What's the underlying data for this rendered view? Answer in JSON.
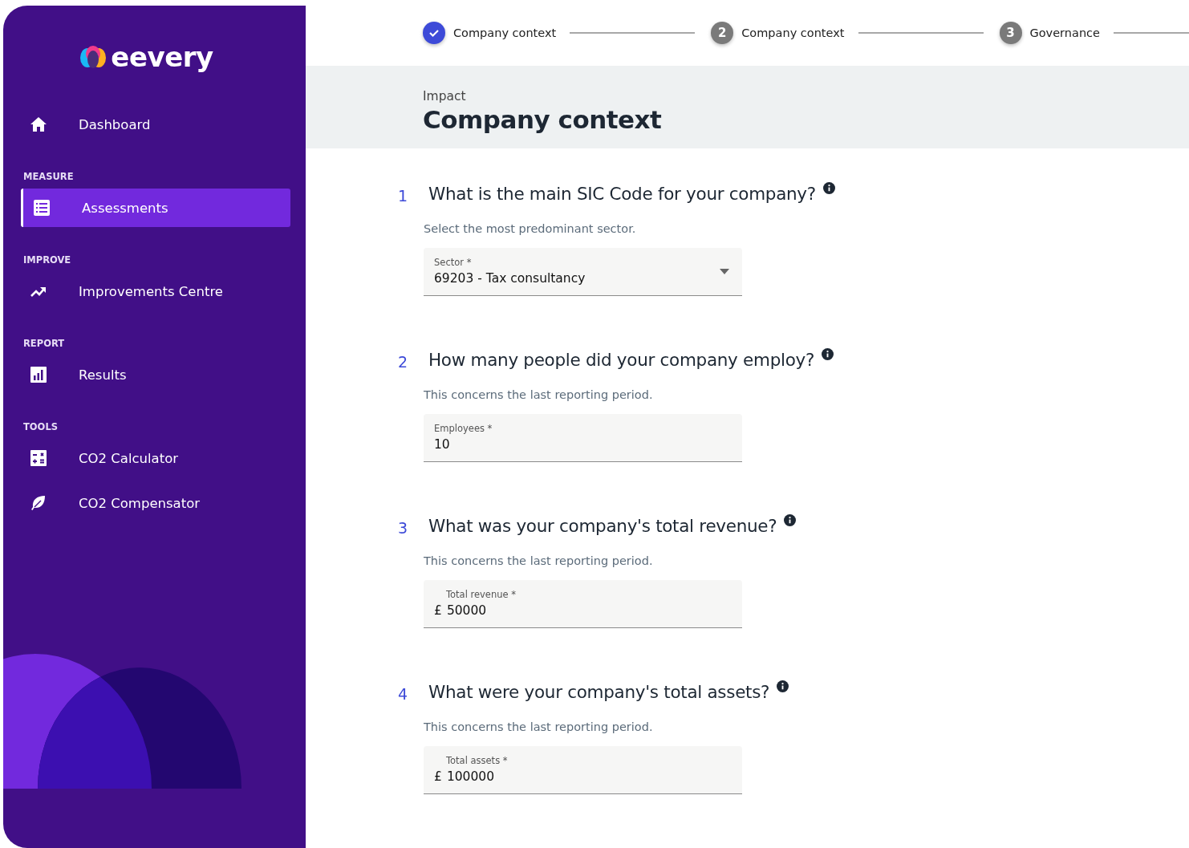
{
  "sidebar": {
    "logo": "eevery",
    "sections": [
      {
        "items": [
          {
            "label": "Dashboard",
            "selected": false
          }
        ]
      },
      {
        "title": "MEASURE",
        "items": [
          {
            "label": "Assessments",
            "selected": true
          }
        ]
      },
      {
        "title": "IMPROVE",
        "items": [
          {
            "label": "Improvements Centre",
            "selected": false
          }
        ]
      },
      {
        "title": "REPORT",
        "items": [
          {
            "label": "Results",
            "selected": false
          }
        ]
      },
      {
        "title": "TOOLS",
        "items": [
          {
            "label": "CO2 Calculator",
            "selected": false
          },
          {
            "label": "CO2 Compensator",
            "selected": false
          }
        ]
      }
    ]
  },
  "stepper": [
    {
      "label": "Company context",
      "done": true
    },
    {
      "number": "2",
      "label": "Company context",
      "done": false
    },
    {
      "number": "3",
      "label": "Governance",
      "done": false
    }
  ],
  "header": {
    "category": "Impact",
    "title": "Company context"
  },
  "questions": [
    {
      "number": "1",
      "text": "What is the main SIC Code for your company?",
      "hint": "Select the most predominant sector.",
      "field": {
        "kind": "select",
        "label": "Sector *",
        "value": "69203 - Tax consultancy"
      }
    },
    {
      "number": "2",
      "text": "How many people did your company employ?",
      "hint": "This concerns the last reporting period.",
      "field": {
        "kind": "input",
        "label": "Employees *",
        "value": "10"
      }
    },
    {
      "number": "3",
      "text": "What was your company's total revenue?",
      "hint": "This concerns the last reporting period.",
      "field": {
        "kind": "input",
        "label": "Total revenue *",
        "prefix": "£",
        "value": "50000"
      }
    },
    {
      "number": "4",
      "text": "What were your company's total assets?",
      "hint": "This concerns the last reporting period.",
      "field": {
        "kind": "input",
        "label": "Total assets *",
        "prefix": "£",
        "value": "100000"
      }
    }
  ]
}
